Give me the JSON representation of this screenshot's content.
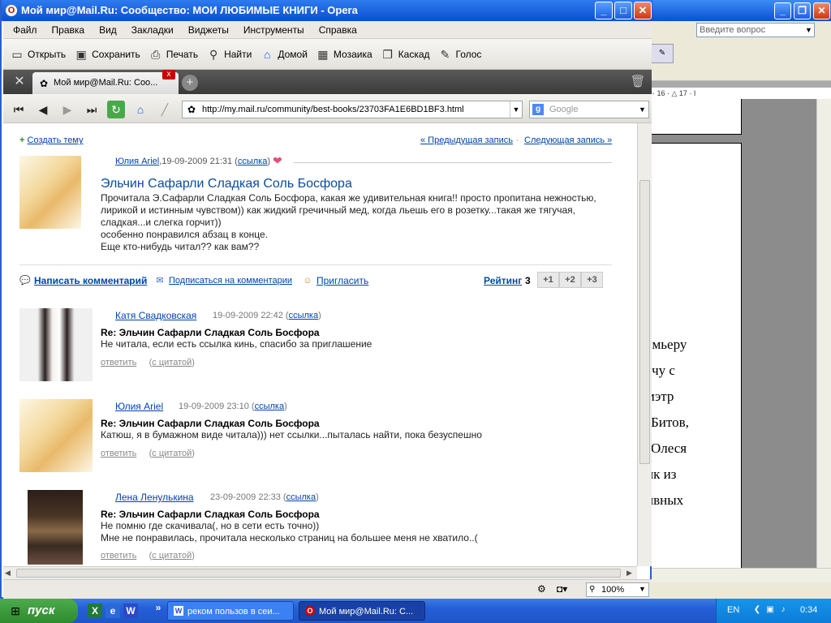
{
  "opera": {
    "title": "Мой мир@Mail.Ru: Сообщество: МОИ ЛЮБИМЫЕ КНИГИ - Opera",
    "menu": [
      "Файл",
      "Правка",
      "Вид",
      "Закладки",
      "Виджеты",
      "Инструменты",
      "Справка"
    ],
    "toolbar": [
      {
        "label": "Открыть",
        "icon": "folder-icon"
      },
      {
        "label": "Сохранить",
        "icon": "floppy-icon"
      },
      {
        "label": "Печать",
        "icon": "printer-icon"
      },
      {
        "label": "Найти",
        "icon": "magnifier-icon"
      },
      {
        "label": "Домой",
        "icon": "home-icon"
      },
      {
        "label": "Мозаика",
        "icon": "tile-icon"
      },
      {
        "label": "Каскад",
        "icon": "cascade-icon"
      },
      {
        "label": "Голос",
        "icon": "microphone-icon"
      }
    ],
    "tab_title": "Мой мир@Mail.Ru: Соо...",
    "address": "http://my.mail.ru/community/best-books/23703FA1E6BD1BF3.html",
    "search_placeholder": "Google",
    "zoom": "100%"
  },
  "page": {
    "create_topic": "Создать тему",
    "prev_entry": "« Предыдущая запись",
    "next_entry": "Следующая запись »",
    "post": {
      "author": "Юлия Ariel",
      "date": ",19-09-2009 21:31 (",
      "link": "ссылка",
      "link_close": ")",
      "title": "Эльчин Сафарли Сладкая Соль Босфора",
      "body": [
        "Прочитала Э.Сафарли Сладкая Соль Босфора, какая же удивительная книга!! просто пропитана нежностью,",
        "лирикой и истинным чувством)) как жидкий гречичный мед, когда льешь его в розетку...такая же тягучая,",
        "сладкая...и слегка горчит))",
        "особенно понравился абзац в конце.",
        "Еще кто-нибудь читал?? как вам??"
      ]
    },
    "actions": {
      "write_comment": "Написать комментарий",
      "subscribe": "Подписаться на комментарии",
      "invite": "Пригласить",
      "rating_label": "Рейтинг",
      "rating_value": "3",
      "rate_buttons": [
        "+1",
        "+2",
        "+3"
      ]
    },
    "comments": [
      {
        "author": "Катя Свадковская",
        "date": "19-09-2009 22:42",
        "link": "ссылка",
        "title": "Re: Эльчин Сафарли Сладкая Соль Босфора",
        "lines": [
          "Не читала, если есть ссылка кинь, спасибо за приглашение"
        ],
        "reply": "ответить",
        "quote": "с цитатой"
      },
      {
        "author": "Юлия Ariel",
        "date": "19-09-2009 23:10",
        "link": "ссылка",
        "title": "Re: Эльчин Сафарли Сладкая Соль Босфора",
        "lines": [
          "Катюш, я в бумажном виде читала))) нет ссылки...пыталась найти, пока безуспешно"
        ],
        "reply": "ответить",
        "quote": "с цитатой"
      },
      {
        "author": "Лена Ленулькина",
        "date": "23-09-2009 22:33",
        "link": "ссылка",
        "title": "Re: Эльчин Сафарли Сладкая Соль Босфора",
        "lines": [
          "Не помню где скачивала(, но в сети есть точно))",
          "Мне не понравилась, прочитала несколько страниц на большее меня не хватило..("
        ],
        "reply": "ответить",
        "quote": "с цитатой"
      }
    ]
  },
  "word": {
    "ask_placeholder": "Введите вопрос",
    "ruler": "· 16 · △ 17 · I",
    "lines": [
      "емьеру",
      "ечу   с",
      "  мэтр",
      "Битов,",
      " Олеся",
      "ик   из",
      "ивных"
    ]
  },
  "taskbar": {
    "start": "пуск",
    "task1": "реком пользов в сеи...",
    "task2": "Мой мир@Mail.Ru: С...",
    "lang": "EN",
    "time": "0:34"
  }
}
